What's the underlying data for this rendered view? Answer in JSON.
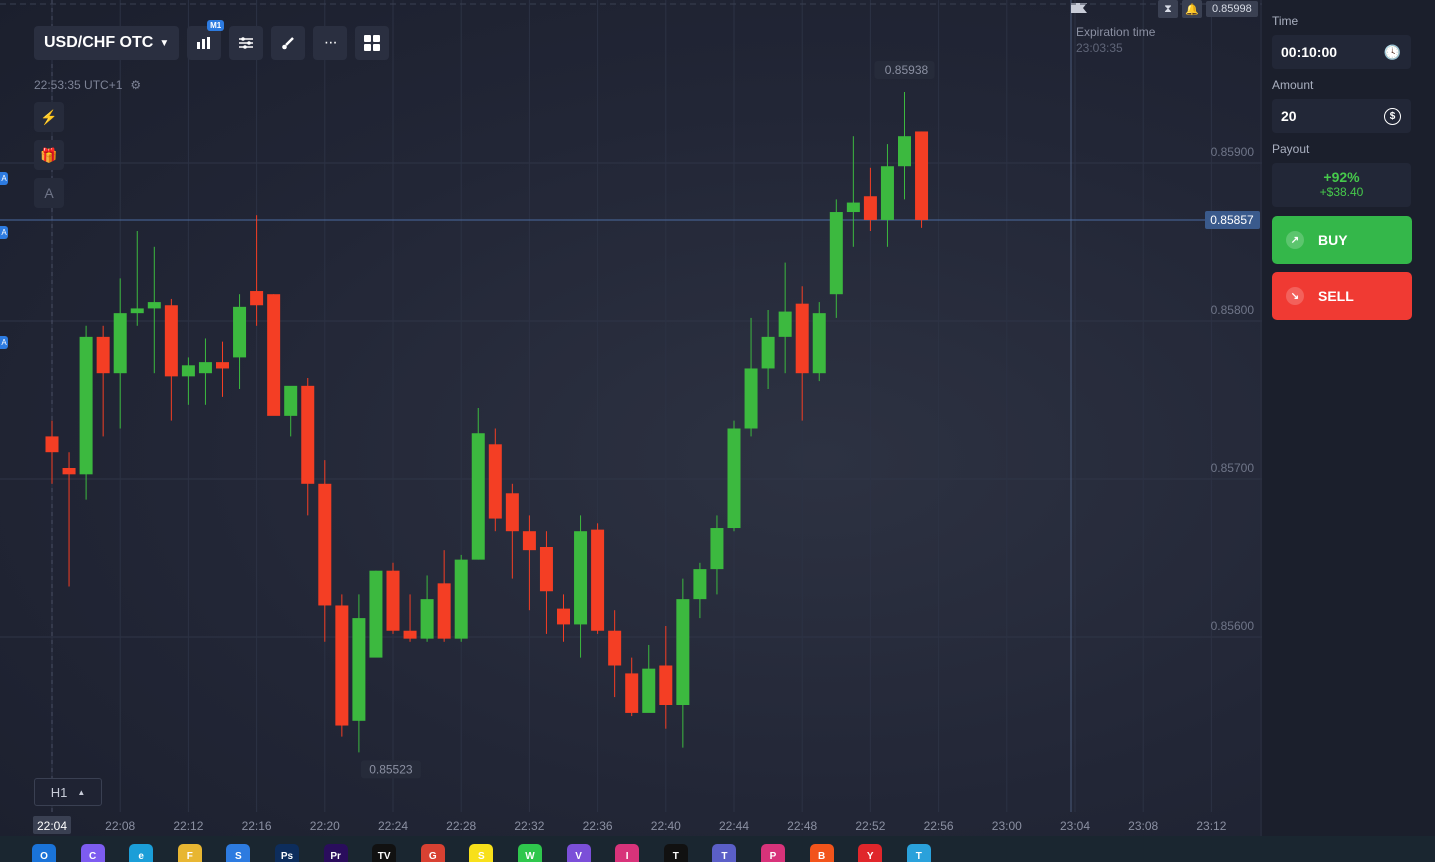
{
  "header": {
    "pair": "USD/CHF OTC",
    "timeframe_badge": "M1",
    "clock": "22:53:35 UTC+1",
    "timeframe_selector": "H1"
  },
  "top_bar": {
    "last_price": "0.85998"
  },
  "expiration": {
    "label": "Expiration time",
    "value": "23:03:35"
  },
  "panel": {
    "time_label": "Time",
    "time_value": "00:10:00",
    "amount_label": "Amount",
    "amount_value": "20",
    "payout_label": "Payout",
    "payout_pct": "+92%",
    "payout_amount": "+$38.40",
    "buy_label": "BUY",
    "sell_label": "SELL"
  },
  "colors": {
    "up": "#3cb93f",
    "down": "#f43e24",
    "buy": "#34b74a",
    "sell": "#f03a33",
    "price_tag": "#3a5a8c"
  },
  "chart_data": {
    "type": "candlestick",
    "current_price": 0.85857,
    "current_price_label": "0.85857",
    "high_label": "0.85938",
    "low_label": "0.85523",
    "y_ticks": [
      {
        "value": 0.859,
        "label": "0.85900"
      },
      {
        "value": 0.858,
        "label": "0.85800"
      },
      {
        "value": 0.857,
        "label": "0.85700"
      },
      {
        "value": 0.856,
        "label": "0.85600"
      }
    ],
    "x_ticks": [
      "22:04",
      "22:08",
      "22:12",
      "22:16",
      "22:20",
      "22:24",
      "22:28",
      "22:32",
      "22:36",
      "22:40",
      "22:44",
      "22:48",
      "22:52",
      "22:56",
      "23:00",
      "23:04",
      "23:08",
      "23:12"
    ],
    "x_active_tick": "22:04",
    "candles": [
      {
        "o": 0.8572,
        "h": 0.8573,
        "l": 0.8569,
        "c": 0.8571
      },
      {
        "o": 0.857,
        "h": 0.8571,
        "l": 0.85625,
        "c": 0.85696
      },
      {
        "o": 0.85696,
        "h": 0.8579,
        "l": 0.8568,
        "c": 0.85783
      },
      {
        "o": 0.85783,
        "h": 0.8579,
        "l": 0.8572,
        "c": 0.8576
      },
      {
        "o": 0.8576,
        "h": 0.8582,
        "l": 0.85725,
        "c": 0.85798
      },
      {
        "o": 0.85798,
        "h": 0.8585,
        "l": 0.8579,
        "c": 0.85801
      },
      {
        "o": 0.85801,
        "h": 0.8584,
        "l": 0.8576,
        "c": 0.85805
      },
      {
        "o": 0.85803,
        "h": 0.85807,
        "l": 0.8573,
        "c": 0.85758
      },
      {
        "o": 0.85758,
        "h": 0.8577,
        "l": 0.8574,
        "c": 0.85765
      },
      {
        "o": 0.8576,
        "h": 0.85782,
        "l": 0.8574,
        "c": 0.85767
      },
      {
        "o": 0.85767,
        "h": 0.8578,
        "l": 0.85745,
        "c": 0.85763
      },
      {
        "o": 0.8577,
        "h": 0.8581,
        "l": 0.8575,
        "c": 0.85802
      },
      {
        "o": 0.85812,
        "h": 0.8586,
        "l": 0.8579,
        "c": 0.85803
      },
      {
        "o": 0.8581,
        "h": 0.8581,
        "l": 0.85735,
        "c": 0.85733
      },
      {
        "o": 0.85733,
        "h": 0.8575,
        "l": 0.8572,
        "c": 0.85752
      },
      {
        "o": 0.85752,
        "h": 0.85757,
        "l": 0.8567,
        "c": 0.8569
      },
      {
        "o": 0.8569,
        "h": 0.85705,
        "l": 0.8559,
        "c": 0.85613
      },
      {
        "o": 0.85613,
        "h": 0.8562,
        "l": 0.8553,
        "c": 0.85537
      },
      {
        "o": 0.8554,
        "h": 0.8562,
        "l": 0.8552,
        "c": 0.85605
      },
      {
        "o": 0.8558,
        "h": 0.85635,
        "l": 0.856,
        "c": 0.85635
      },
      {
        "o": 0.85635,
        "h": 0.8564,
        "l": 0.85595,
        "c": 0.85597
      },
      {
        "o": 0.85597,
        "h": 0.8562,
        "l": 0.8559,
        "c": 0.85592
      },
      {
        "o": 0.85592,
        "h": 0.85632,
        "l": 0.8559,
        "c": 0.85617
      },
      {
        "o": 0.85627,
        "h": 0.85648,
        "l": 0.8559,
        "c": 0.85592
      },
      {
        "o": 0.85592,
        "h": 0.85645,
        "l": 0.8559,
        "c": 0.85642
      },
      {
        "o": 0.85642,
        "h": 0.85738,
        "l": 0.85642,
        "c": 0.85722
      },
      {
        "o": 0.85715,
        "h": 0.85725,
        "l": 0.8566,
        "c": 0.85668
      },
      {
        "o": 0.85684,
        "h": 0.8569,
        "l": 0.8563,
        "c": 0.8566
      },
      {
        "o": 0.8566,
        "h": 0.8567,
        "l": 0.8561,
        "c": 0.85648
      },
      {
        "o": 0.8565,
        "h": 0.8566,
        "l": 0.85595,
        "c": 0.85622
      },
      {
        "o": 0.85611,
        "h": 0.8562,
        "l": 0.8559,
        "c": 0.85601
      },
      {
        "o": 0.85601,
        "h": 0.8567,
        "l": 0.8558,
        "c": 0.8566
      },
      {
        "o": 0.85661,
        "h": 0.85665,
        "l": 0.85595,
        "c": 0.85597
      },
      {
        "o": 0.85597,
        "h": 0.8561,
        "l": 0.85555,
        "c": 0.85575
      },
      {
        "o": 0.8557,
        "h": 0.8558,
        "l": 0.85543,
        "c": 0.85545
      },
      {
        "o": 0.85545,
        "h": 0.85588,
        "l": 0.8555,
        "c": 0.85573
      },
      {
        "o": 0.85575,
        "h": 0.856,
        "l": 0.85535,
        "c": 0.8555
      },
      {
        "o": 0.8555,
        "h": 0.8563,
        "l": 0.85523,
        "c": 0.85617
      },
      {
        "o": 0.85617,
        "h": 0.8564,
        "l": 0.85605,
        "c": 0.85636
      },
      {
        "o": 0.85636,
        "h": 0.8567,
        "l": 0.8562,
        "c": 0.85662
      },
      {
        "o": 0.85662,
        "h": 0.8573,
        "l": 0.8566,
        "c": 0.85725
      },
      {
        "o": 0.85725,
        "h": 0.85795,
        "l": 0.8572,
        "c": 0.85763
      },
      {
        "o": 0.85763,
        "h": 0.858,
        "l": 0.8575,
        "c": 0.85783
      },
      {
        "o": 0.85783,
        "h": 0.8583,
        "l": 0.8576,
        "c": 0.85799
      },
      {
        "o": 0.85804,
        "h": 0.85815,
        "l": 0.8573,
        "c": 0.8576
      },
      {
        "o": 0.8576,
        "h": 0.85805,
        "l": 0.85755,
        "c": 0.85798
      },
      {
        "o": 0.8581,
        "h": 0.8587,
        "l": 0.85795,
        "c": 0.85862
      },
      {
        "o": 0.85862,
        "h": 0.8591,
        "l": 0.8584,
        "c": 0.85868
      },
      {
        "o": 0.85872,
        "h": 0.8589,
        "l": 0.8585,
        "c": 0.85857
      },
      {
        "o": 0.85857,
        "h": 0.85905,
        "l": 0.8584,
        "c": 0.85891
      },
      {
        "o": 0.85891,
        "h": 0.85938,
        "l": 0.8587,
        "c": 0.8591
      },
      {
        "o": 0.85913,
        "h": 0.85913,
        "l": 0.85852,
        "c": 0.85857
      }
    ]
  },
  "taskbar": {
    "apps": [
      {
        "icon": "outlook-icon",
        "label": "O",
        "color": "#1a73d8"
      },
      {
        "icon": "copilot-icon",
        "label": "C",
        "color": "#7d5cf0"
      },
      {
        "icon": "edge-icon",
        "label": "e",
        "color": "#1b9ed8"
      },
      {
        "icon": "file-explorer-icon",
        "label": "F",
        "color": "#e8b632"
      },
      {
        "icon": "store-icon",
        "label": "S",
        "color": "#2d7be0"
      },
      {
        "icon": "photoshop-icon",
        "label": "Ps",
        "color": "#0d2d5c"
      },
      {
        "icon": "premiere-icon",
        "label": "Pr",
        "color": "#2a0d5c"
      },
      {
        "icon": "tradingview-icon",
        "label": "TV",
        "color": "#111111"
      },
      {
        "icon": "chrome-icon",
        "label": "G",
        "color": "#d84132"
      },
      {
        "icon": "snapchat-icon",
        "label": "S",
        "color": "#f8e01a"
      },
      {
        "icon": "whatsapp-icon",
        "label": "W",
        "color": "#2fc74d"
      },
      {
        "icon": "viber-icon",
        "label": "V",
        "color": "#7b4fd8"
      },
      {
        "icon": "instagram-icon",
        "label": "I",
        "color": "#d8337a"
      },
      {
        "icon": "tiktok-icon",
        "label": "T",
        "color": "#111111"
      },
      {
        "icon": "teams-icon",
        "label": "T",
        "color": "#5b5fc7"
      },
      {
        "icon": "paint-icon",
        "label": "P",
        "color": "#d8337a"
      },
      {
        "icon": "brave-icon",
        "label": "B",
        "color": "#f2541b"
      },
      {
        "icon": "youtube-music-icon",
        "label": "Y",
        "color": "#e0262b"
      },
      {
        "icon": "telegram-icon",
        "label": "T",
        "color": "#2aa1db"
      }
    ]
  }
}
